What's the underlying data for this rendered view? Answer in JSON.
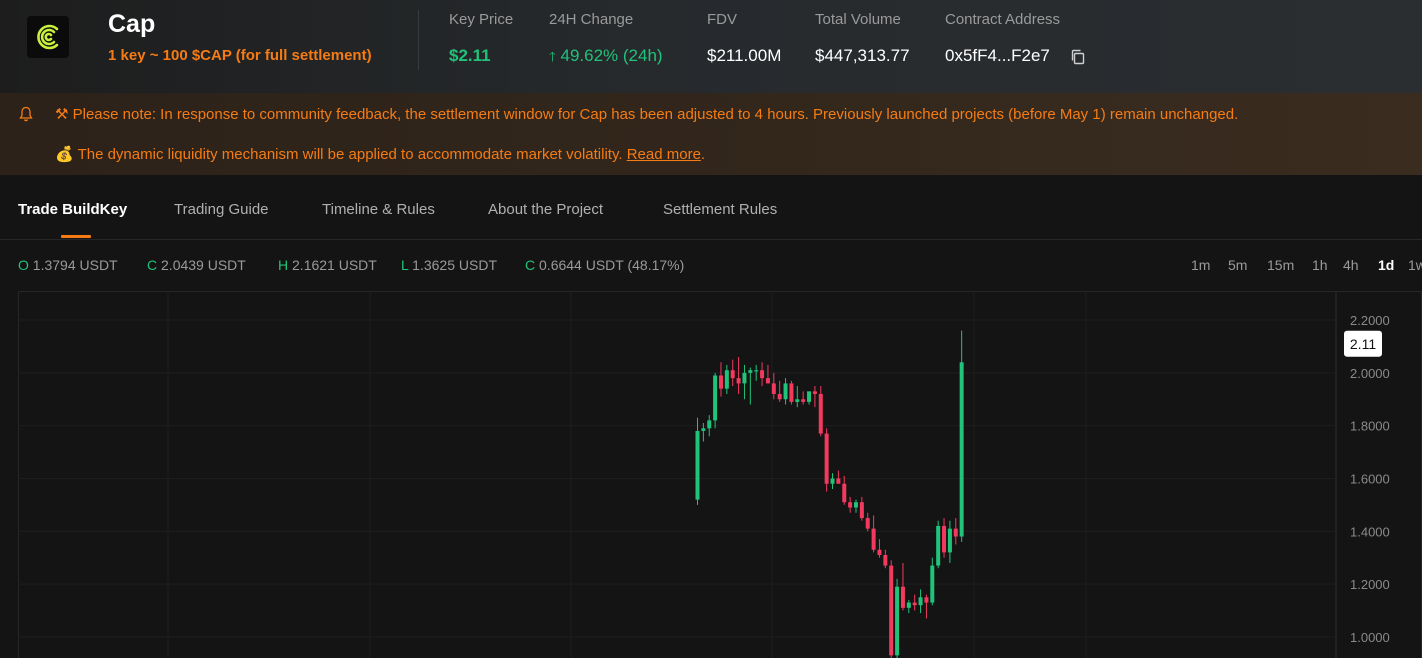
{
  "header": {
    "title": "Cap",
    "subtitle": "1 key ~ 100 $CAP (for full settlement)",
    "stats": {
      "key_price_label": "Key Price",
      "key_price_value": "$2.11",
      "change_label": "24H Change",
      "change_value": "49.62% (24h)",
      "fdv_label": "FDV",
      "fdv_value": "$211.00M",
      "volume_label": "Total Volume",
      "volume_value": "$447,313.77",
      "contract_label": "Contract Address",
      "contract_value": "0x5fF4...F2e7"
    }
  },
  "notice": {
    "line1": "⚒ Please note: In response to community feedback, the settlement window for Cap has been adjusted to 4 hours. Previously launched projects (before May 1) remain unchanged.",
    "line2_prefix": "💰 The dynamic liquidity mechanism will be applied to accommodate market volatility. ",
    "line2_link": "Read more",
    "line2_suffix": "."
  },
  "tabs": [
    "Trade BuildKey",
    "Trading Guide",
    "Timeline & Rules",
    "About the Project",
    "Settlement Rules"
  ],
  "ohlc": {
    "o_label": "O",
    "o_value": "1.3794 USDT",
    "c_label": "C",
    "c_value": "2.0439 USDT",
    "h_label": "H",
    "h_value": "2.1621 USDT",
    "l_label": "L",
    "l_value": "1.3625 USDT",
    "c2_label": "C",
    "c2_value": "0.6644 USDT (48.17%)"
  },
  "timeframes": [
    "1m",
    "5m",
    "15m",
    "1h",
    "4h",
    "1d",
    "1w"
  ],
  "active_timeframe": "1d",
  "colors": {
    "accent": "#f57c14",
    "up": "#21c27a",
    "down": "#f23a5f"
  },
  "chart_data": {
    "type": "candlestick",
    "y_ticks": [
      "2.2000",
      "2.0000",
      "1.8000",
      "1.6000",
      "1.4000",
      "1.2000",
      "1.0000"
    ],
    "ylim": [
      0.92,
      2.31
    ],
    "last_price_label": "2.11",
    "candles": [
      {
        "o": 1.52,
        "h": 1.83,
        "l": 1.5,
        "c": 1.78
      },
      {
        "o": 1.78,
        "h": 1.81,
        "l": 1.74,
        "c": 1.79
      },
      {
        "o": 1.79,
        "h": 1.84,
        "l": 1.76,
        "c": 1.82
      },
      {
        "o": 1.82,
        "h": 2.0,
        "l": 1.79,
        "c": 1.99
      },
      {
        "o": 1.99,
        "h": 2.04,
        "l": 1.91,
        "c": 1.94
      },
      {
        "o": 1.94,
        "h": 2.03,
        "l": 1.92,
        "c": 2.01
      },
      {
        "o": 2.01,
        "h": 2.05,
        "l": 1.95,
        "c": 1.98
      },
      {
        "o": 1.98,
        "h": 2.06,
        "l": 1.92,
        "c": 1.96
      },
      {
        "o": 1.96,
        "h": 2.03,
        "l": 1.9,
        "c": 2.0
      },
      {
        "o": 2.0,
        "h": 2.02,
        "l": 1.88,
        "c": 2.01
      },
      {
        "o": 2.01,
        "h": 2.03,
        "l": 1.97,
        "c": 2.01
      },
      {
        "o": 2.01,
        "h": 2.04,
        "l": 1.95,
        "c": 1.98
      },
      {
        "o": 1.98,
        "h": 2.03,
        "l": 1.96,
        "c": 1.96
      },
      {
        "o": 1.96,
        "h": 2.0,
        "l": 1.9,
        "c": 1.92
      },
      {
        "o": 1.92,
        "h": 1.97,
        "l": 1.89,
        "c": 1.9
      },
      {
        "o": 1.9,
        "h": 1.98,
        "l": 1.88,
        "c": 1.96
      },
      {
        "o": 1.96,
        "h": 1.97,
        "l": 1.88,
        "c": 1.89
      },
      {
        "o": 1.89,
        "h": 1.95,
        "l": 1.87,
        "c": 1.9
      },
      {
        "o": 1.9,
        "h": 1.93,
        "l": 1.88,
        "c": 1.89
      },
      {
        "o": 1.89,
        "h": 1.92,
        "l": 1.88,
        "c": 1.93
      },
      {
        "o": 1.93,
        "h": 1.95,
        "l": 1.87,
        "c": 1.92
      },
      {
        "o": 1.92,
        "h": 1.95,
        "l": 1.76,
        "c": 1.77
      },
      {
        "o": 1.77,
        "h": 1.79,
        "l": 1.55,
        "c": 1.58
      },
      {
        "o": 1.58,
        "h": 1.62,
        "l": 1.56,
        "c": 1.6
      },
      {
        "o": 1.6,
        "h": 1.63,
        "l": 1.58,
        "c": 1.58
      },
      {
        "o": 1.58,
        "h": 1.61,
        "l": 1.5,
        "c": 1.51
      },
      {
        "o": 1.51,
        "h": 1.53,
        "l": 1.47,
        "c": 1.49
      },
      {
        "o": 1.49,
        "h": 1.52,
        "l": 1.47,
        "c": 1.51
      },
      {
        "o": 1.51,
        "h": 1.53,
        "l": 1.44,
        "c": 1.45
      },
      {
        "o": 1.45,
        "h": 1.47,
        "l": 1.4,
        "c": 1.41
      },
      {
        "o": 1.41,
        "h": 1.46,
        "l": 1.32,
        "c": 1.33
      },
      {
        "o": 1.33,
        "h": 1.37,
        "l": 1.3,
        "c": 1.31
      },
      {
        "o": 1.31,
        "h": 1.33,
        "l": 1.26,
        "c": 1.27
      },
      {
        "o": 1.27,
        "h": 1.29,
        "l": 0.92,
        "c": 0.93
      },
      {
        "o": 0.93,
        "h": 1.22,
        "l": 0.92,
        "c": 1.19
      },
      {
        "o": 1.19,
        "h": 1.28,
        "l": 1.1,
        "c": 1.11
      },
      {
        "o": 1.11,
        "h": 1.14,
        "l": 1.09,
        "c": 1.13
      },
      {
        "o": 1.13,
        "h": 1.16,
        "l": 1.1,
        "c": 1.12
      },
      {
        "o": 1.12,
        "h": 1.18,
        "l": 1.09,
        "c": 1.15
      },
      {
        "o": 1.15,
        "h": 1.16,
        "l": 1.07,
        "c": 1.13
      },
      {
        "o": 1.13,
        "h": 1.3,
        "l": 1.12,
        "c": 1.27
      },
      {
        "o": 1.27,
        "h": 1.44,
        "l": 1.26,
        "c": 1.42
      },
      {
        "o": 1.42,
        "h": 1.45,
        "l": 1.3,
        "c": 1.32
      },
      {
        "o": 1.32,
        "h": 1.44,
        "l": 1.28,
        "c": 1.41
      },
      {
        "o": 1.41,
        "h": 1.45,
        "l": 1.35,
        "c": 1.38
      },
      {
        "o": 1.38,
        "h": 2.16,
        "l": 1.36,
        "c": 2.04
      }
    ]
  }
}
